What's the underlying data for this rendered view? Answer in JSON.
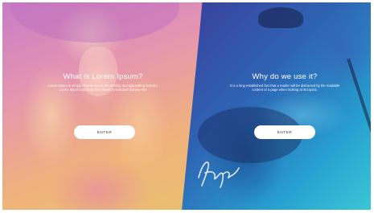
{
  "left": {
    "heading": "What is Lorem Ipsum?",
    "body": "Lorem Ipsum is simply dummy text of the printing and typesetting industry. Lorem Ipsum has been the industry's standard dummy text",
    "button_label": "ENTER"
  },
  "right": {
    "heading": "Why do we use it?",
    "body": "It is a long established fact that a reader will be distracted by the readable content of a page when looking at its layout.",
    "button_label": "ENTER"
  },
  "colors": {
    "left_gradient": [
      "#c87cc6",
      "#e595b0",
      "#f0b27c",
      "#e9c06e"
    ],
    "right_gradient": [
      "#3a3f9a",
      "#2e63b4",
      "#27a0d0",
      "#3bc7d6"
    ],
    "button_bg": "#ffffff",
    "text": "#ffffff"
  }
}
